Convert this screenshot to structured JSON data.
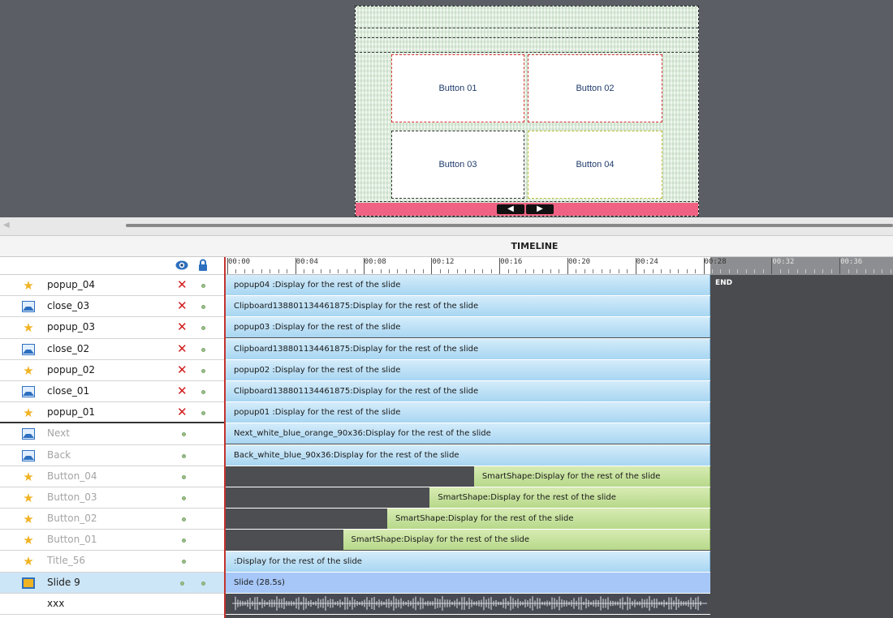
{
  "stage": {
    "buttons": [
      "Button 01",
      "Button 02",
      "Button 03",
      "Button 04"
    ],
    "nav_back": "◀",
    "nav_next": "▶"
  },
  "panel": {
    "title": "TIMELINE"
  },
  "ruler": {
    "labels": [
      "00:00",
      "00:04",
      "00:08",
      "00:12",
      "00:16",
      "00:20",
      "00:24",
      "00:28",
      "00:32",
      "00:36"
    ]
  },
  "end_label": "END",
  "layers": [
    {
      "name": "popup_04",
      "icon": "star-icon",
      "dim": false,
      "hidden_x": "✕",
      "bar": "popup04 :Display for the rest of the slide",
      "color": "blue",
      "start": 0
    },
    {
      "name": "close_03",
      "icon": "image-icon",
      "dim": false,
      "hidden_x": "✕",
      "bar": "Clipboard138801134461875:Display for the rest of the slide",
      "color": "blue",
      "start": 0
    },
    {
      "name": "popup_03",
      "icon": "star-icon",
      "dim": false,
      "hidden_x": "✕",
      "bar": "popup03 :Display for the rest of the slide",
      "color": "blue",
      "start": 0
    },
    {
      "name": "close_02",
      "icon": "image-icon",
      "dim": false,
      "hidden_x": "✕",
      "bar": "Clipboard138801134461875:Display for the rest of the slide",
      "color": "blue",
      "start": 0
    },
    {
      "name": "popup_02",
      "icon": "star-icon",
      "dim": false,
      "hidden_x": "✕",
      "bar": "popup02 :Display for the rest of the slide",
      "color": "blue",
      "start": 0
    },
    {
      "name": "close_01",
      "icon": "image-icon",
      "dim": false,
      "hidden_x": "✕",
      "bar": "Clipboard138801134461875:Display for the rest of the slide",
      "color": "blue",
      "start": 0
    },
    {
      "name": "popup_01",
      "icon": "star-icon",
      "dim": false,
      "hidden_x": "✕",
      "bar": "popup01 :Display for the rest of the slide",
      "color": "blue",
      "start": 0
    },
    {
      "name": "Next",
      "icon": "image-icon",
      "dim": true,
      "hidden_x": "",
      "bar": "Next_white_blue_orange_90x36:Display for the rest of the slide",
      "color": "blue",
      "start": 0
    },
    {
      "name": "Back",
      "icon": "image-icon",
      "dim": true,
      "hidden_x": "",
      "bar": "Back_white_blue_90x36:Display for the rest of the slide",
      "color": "blue",
      "start": 0
    },
    {
      "name": "Button_04",
      "icon": "star-icon",
      "dim": true,
      "hidden_x": "",
      "bar": "SmartShape:Display for the rest of the slide",
      "color": "green",
      "start": 14.6
    },
    {
      "name": "Button_03",
      "icon": "star-icon",
      "dim": true,
      "hidden_x": "",
      "bar": "SmartShape:Display for the rest of the slide",
      "color": "green",
      "start": 12.0
    },
    {
      "name": "Button_02",
      "icon": "star-icon",
      "dim": true,
      "hidden_x": "",
      "bar": "SmartShape:Display for the rest of the slide",
      "color": "green",
      "start": 9.5
    },
    {
      "name": "Button_01",
      "icon": "star-icon",
      "dim": true,
      "hidden_x": "",
      "bar": "SmartShape:Display for the rest of the slide",
      "color": "green",
      "start": 6.9
    },
    {
      "name": "Title_56",
      "icon": "star-icon",
      "dim": true,
      "hidden_x": "",
      "bar": " :Display for the rest of the slide",
      "color": "blue",
      "start": 0
    },
    {
      "name": "Slide 9",
      "icon": "slide-icon",
      "dim": false,
      "hidden_x": "",
      "bar": "Slide (28.5s)",
      "color": "slide",
      "start": 0
    },
    {
      "name": "xxx",
      "icon": "",
      "dim": false,
      "hidden_x": "",
      "bar": "",
      "color": "audio",
      "start": 0
    }
  ],
  "slide_duration": 28.5,
  "colors": {
    "accent": "#c3332f",
    "track_blue": "#a8d6f2",
    "track_green": "#b7d98a",
    "footer_pink": "#f06283"
  }
}
